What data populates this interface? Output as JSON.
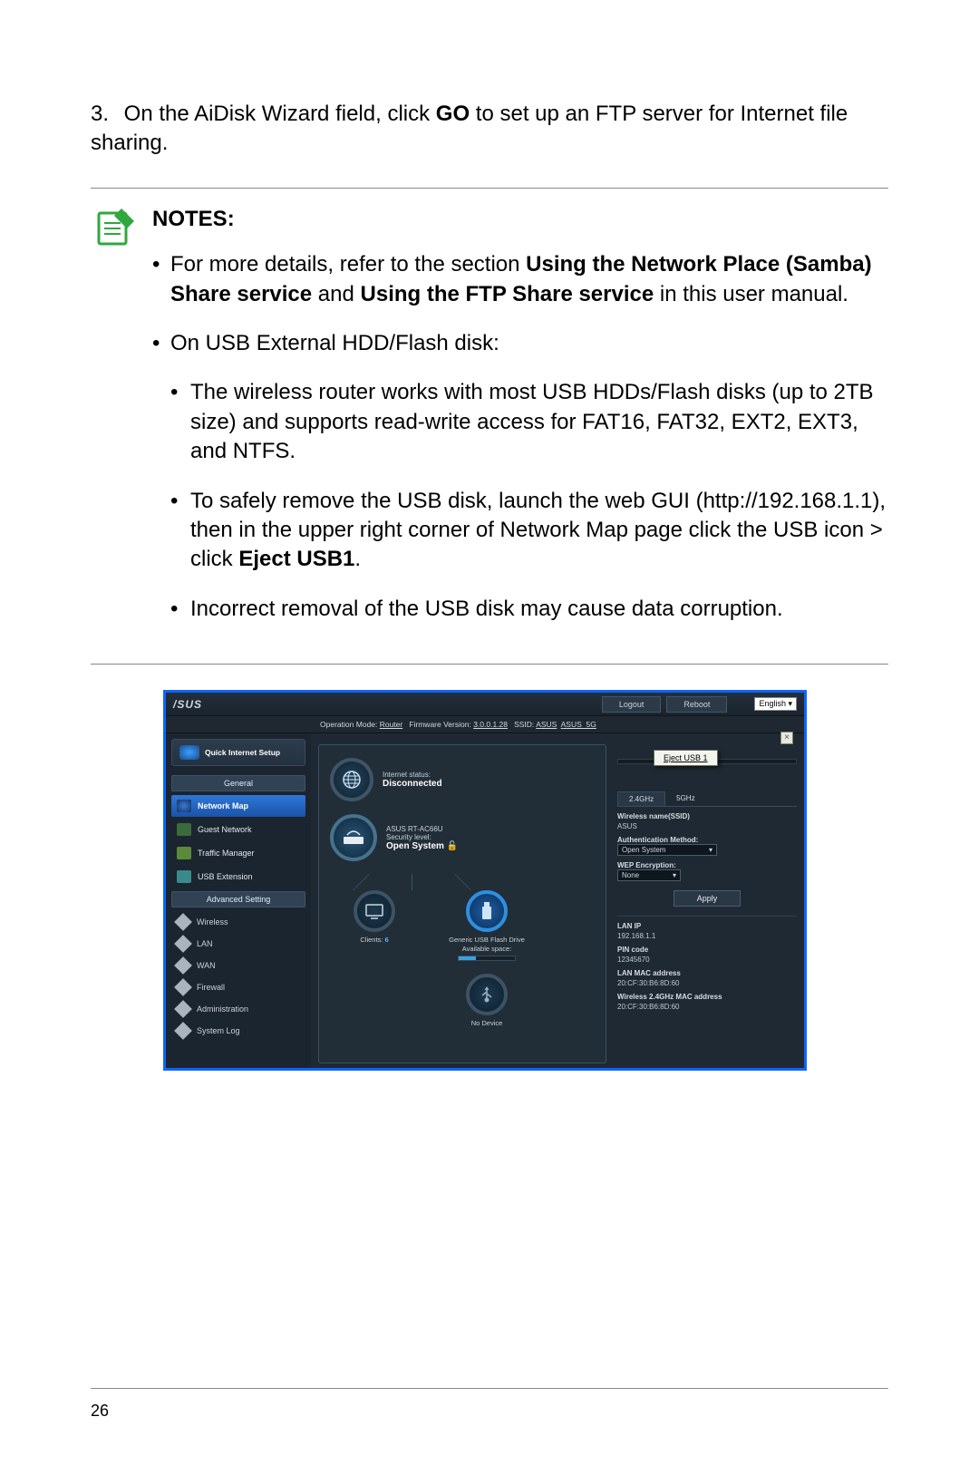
{
  "step": {
    "number": "3.",
    "text_a": "On the AiDisk Wizard field, click ",
    "bold": "GO",
    "text_b": " to set up an FTP server for Internet file sharing."
  },
  "notes": {
    "title": "NOTES",
    "b1a": "For more details, refer to the section ",
    "b1b": "Using the Network Place (Samba) Share service",
    "b1c": " and ",
    "b1d": "Using the FTP Share service",
    "b1e": " in this user manual.",
    "b2": "On USB External HDD/Flash disk:",
    "b2a": "The wireless router works with most USB HDDs/Flash disks (up to 2TB size) and supports read-write access for FAT16, FAT32, EXT2, EXT3, and NTFS.",
    "b2b_a": "To safely remove the USB disk, launch the web GUI (http://192.168.1.1), then in the upper right corner of Network Map page click the USB icon > click ",
    "b2b_b": "Eject USB1",
    "b2b_c": ".",
    "b2c": "Incorrect removal of the USB disk may cause data corruption."
  },
  "shot": {
    "logo": "/SUS",
    "logout": "Logout",
    "reboot": "Reboot",
    "lang": "English",
    "op_mode_label": "Operation Mode:",
    "op_mode": "Router",
    "fw_label": "Firmware Version:",
    "fw": "3.0.0.1.28",
    "ssid_label": "SSID:",
    "ssid1": "ASUS",
    "ssid2": "ASUS_5G",
    "qis": "Quick Internet Setup",
    "section_general": "General",
    "nav": {
      "netmap": "Network Map",
      "guest": "Guest Network",
      "traffic": "Traffic Manager",
      "usb": "USB Extension"
    },
    "section_adv": "Advanced Setting",
    "adv": {
      "wireless": "Wireless",
      "lan": "LAN",
      "wan": "WAN",
      "firewall": "Firewall",
      "admin": "Administration",
      "syslog": "System Log"
    },
    "center": {
      "inet_label": "Internet status:",
      "inet_status": "Disconnected",
      "router_model": "ASUS RT-AC66U",
      "sec_label": "Security level:",
      "sec_value": "Open System",
      "clients_label": "Clients:",
      "clients_value": "6",
      "usb_label": "Generic USB Flash Drive",
      "avail_label": "Available space:",
      "nodev": "No Device"
    },
    "eject": "Eject USB 1",
    "right": {
      "tab24": "2.4GHz",
      "tab5": "5GHz",
      "wname_label": "Wireless name(SSID)",
      "wname_value": "ASUS",
      "auth_label": "Authentication Method:",
      "auth_value": "Open System",
      "wep_label": "WEP Encryption:",
      "wep_value": "None",
      "apply": "Apply",
      "lanip_label": "LAN IP",
      "lanip": "192.168.1.1",
      "pin_label": "PIN code",
      "pin": "12345670",
      "mac_label": "LAN MAC address",
      "mac": "20:CF:30:B6:8D:60",
      "wmac_label": "Wireless 2.4GHz MAC address",
      "wmac": "20:CF:30:B6:8D:60"
    }
  },
  "page_number": "26"
}
